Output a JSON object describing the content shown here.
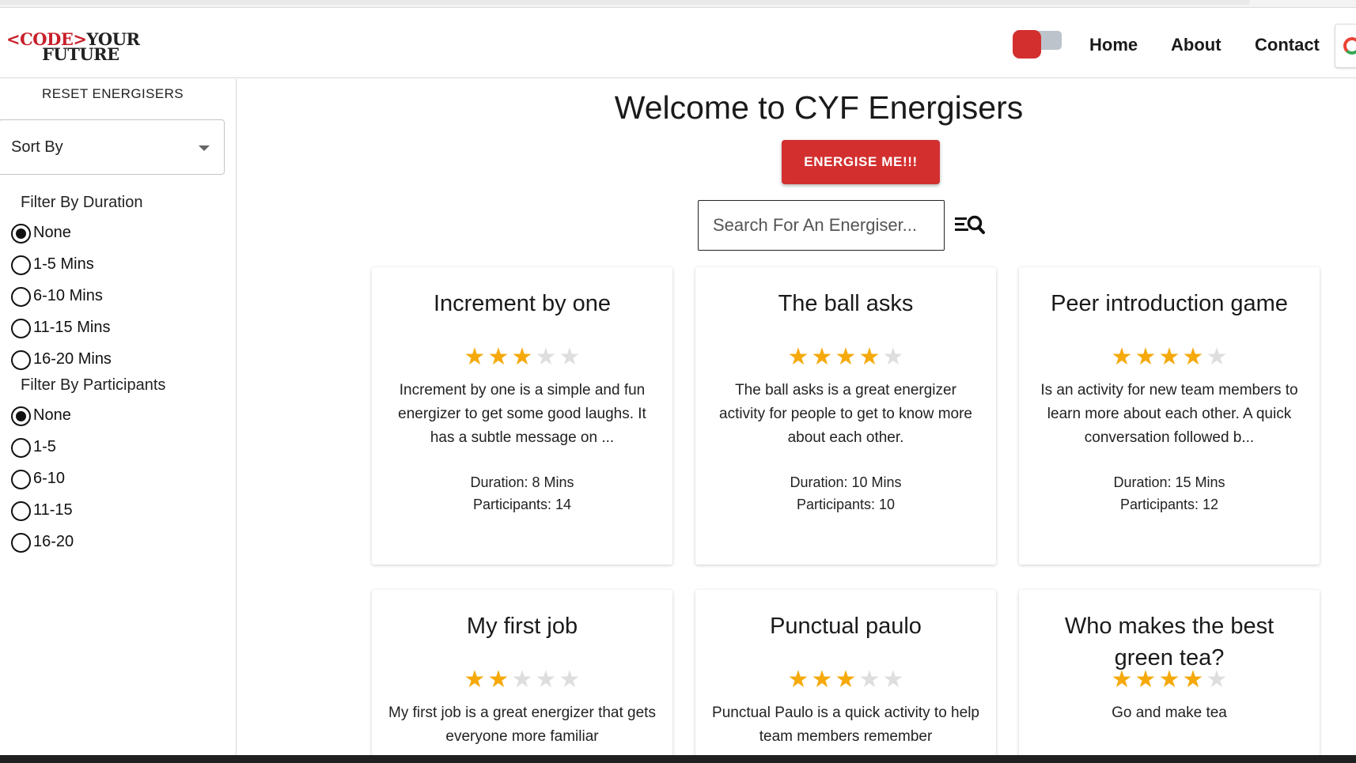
{
  "header": {
    "logo_line1_red": "<CODE>",
    "logo_line1_black": "YOUR",
    "logo_line2": "FUTURE",
    "nav": [
      {
        "label": "Home"
      },
      {
        "label": "About"
      },
      {
        "label": "Contact"
      }
    ],
    "theme_toggle": "dark-mode-toggle",
    "google_icon": "google-icon"
  },
  "sidebar": {
    "reset_label": "RESET ENERGISERS",
    "sort_label": "Sort By",
    "duration_title": "Filter By Duration",
    "duration_options": [
      "None",
      "1-5 Mins",
      "6-10 Mins",
      "11-15 Mins",
      "16-20 Mins"
    ],
    "duration_selected": "None",
    "participants_title": "Filter By Participants",
    "participants_options": [
      "None",
      "1-5",
      "6-10",
      "11-15",
      "16-20"
    ],
    "participants_selected": "None"
  },
  "main": {
    "welcome": "Welcome to CYF Energisers",
    "energise_label": "ENERGISE ME!!!",
    "search_placeholder": "Search For An Energiser...",
    "cards": [
      {
        "title": "Increment by one",
        "rating": 3,
        "description": "Increment by one is a simple and fun energizer to get some good laughs. It has a subtle message on ...",
        "duration": "Duration: 8 Mins",
        "participants": "Participants: 14"
      },
      {
        "title": "The ball asks",
        "rating": 4,
        "description": "The ball asks is a great energizer activity for people to get to know more about each other.",
        "duration": "Duration: 10 Mins",
        "participants": "Participants: 10"
      },
      {
        "title": "Peer introduction game",
        "rating": 4,
        "description": "Is an activity for new team members to learn more about each other. A quick conversation followed b...",
        "duration": "Duration: 15 Mins",
        "participants": "Participants: 12"
      },
      {
        "title": "My first job",
        "rating": 2,
        "description": "My first job is a great energizer that gets everyone more familiar",
        "duration": "",
        "participants": ""
      },
      {
        "title": "Punctual paulo",
        "rating": 3,
        "description": "Punctual Paulo is a quick activity to help team members remember",
        "duration": "",
        "participants": ""
      },
      {
        "title": "Who makes the best green tea?",
        "rating": 4,
        "description": "Go and make tea",
        "duration": "",
        "participants": ""
      }
    ]
  },
  "colors": {
    "accent_red": "#d32f2f",
    "star_on": "#f5a90a",
    "star_off": "#dedede"
  }
}
